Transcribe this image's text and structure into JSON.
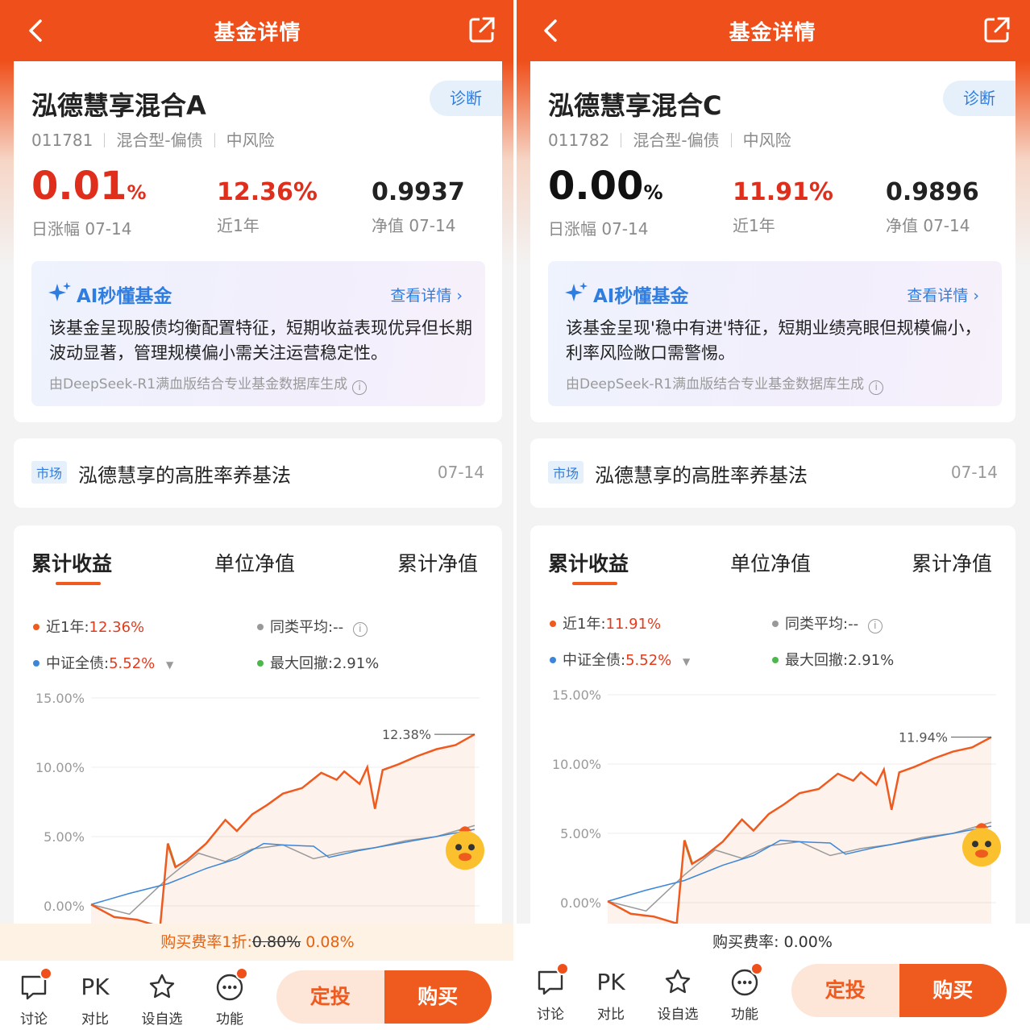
{
  "header_title": "基金详情",
  "diagnose_label": "诊断",
  "ai": {
    "title": "AI秒懂基金",
    "more": "查看详情",
    "source": "由DeepSeek-R1满血版结合专业基金数据库生成"
  },
  "news": {
    "tag": "市场",
    "title": "泓德慧享的高胜率养基法",
    "date": "07-14"
  },
  "tabs": [
    "累计收益",
    "单位净值",
    "累计净值"
  ],
  "bottom": {
    "discuss": "讨论",
    "pk": "PK",
    "compare": "对比",
    "watch": "设自选",
    "func": "功能",
    "dingtou": "定投",
    "buy": "购买"
  },
  "colors": {
    "accent": "#ef4f1a",
    "fund_line": "#ef5a1f",
    "index_line": "#3b86d8",
    "peer_line": "#999999",
    "drawdown": "#4cb84c",
    "ai_blue": "#2f7de1"
  },
  "funds": [
    {
      "name": "泓德慧享混合A",
      "code": "011781",
      "type": "混合型-偏债",
      "risk": "中风险",
      "daily_change": "0.01",
      "daily_unit": "%",
      "daily_label": "日涨幅 07-14",
      "year_return": "12.36%",
      "year_label": "近1年",
      "nav": "0.9937",
      "nav_label": "净值 07-14",
      "ai_summary": "该基金呈现股债均衡配置特征，短期收益表现优异但长期波动显著，管理规模偏小需关注运营稳定性。",
      "legend": {
        "near_year_label": "近1年:",
        "near_year": "12.36%",
        "peer_label": "同类平均:",
        "peer": "--",
        "index_label": "中证全债:",
        "index": "5.52%",
        "drawdown_label": "最大回撤:",
        "drawdown": "2.91%"
      },
      "fee_text": "购买费率1折:",
      "fee_original": "0.80%",
      "fee_value": "0.08%",
      "chart_data": {
        "type": "line",
        "yticks": [
          "15.00%",
          "10.00%",
          "5.00%",
          "0.00%"
        ],
        "ylim": [
          0,
          15
        ],
        "end_label": "12.38%",
        "series": [
          {
            "name": "近1年",
            "points": [
              [
                0,
                0.1
              ],
              [
                0.06,
                -0.8
              ],
              [
                0.12,
                -1.0
              ],
              [
                0.18,
                -1.5
              ],
              [
                0.2,
                4.5
              ],
              [
                0.22,
                2.8
              ],
              [
                0.25,
                3.3
              ],
              [
                0.3,
                4.5
              ],
              [
                0.35,
                6.2
              ],
              [
                0.38,
                5.4
              ],
              [
                0.42,
                6.6
              ],
              [
                0.46,
                7.3
              ],
              [
                0.5,
                8.1
              ],
              [
                0.55,
                8.5
              ],
              [
                0.6,
                9.6
              ],
              [
                0.64,
                9.1
              ],
              [
                0.66,
                9.7
              ],
              [
                0.7,
                8.8
              ],
              [
                0.72,
                10.0
              ],
              [
                0.74,
                7.0
              ],
              [
                0.76,
                9.8
              ],
              [
                0.8,
                10.2
              ],
              [
                0.85,
                10.8
              ],
              [
                0.9,
                11.3
              ],
              [
                0.95,
                11.6
              ],
              [
                1.0,
                12.38
              ]
            ]
          },
          {
            "name": "中证全债",
            "points": [
              [
                0,
                0.1
              ],
              [
                0.1,
                0.9
              ],
              [
                0.2,
                1.6
              ],
              [
                0.3,
                2.7
              ],
              [
                0.38,
                3.4
              ],
              [
                0.45,
                4.5
              ],
              [
                0.5,
                4.4
              ],
              [
                0.58,
                4.3
              ],
              [
                0.62,
                3.5
              ],
              [
                0.7,
                4.0
              ],
              [
                0.8,
                4.5
              ],
              [
                0.9,
                5.0
              ],
              [
                1.0,
                5.52
              ]
            ]
          },
          {
            "name": "同类平均",
            "points": [
              [
                0,
                0.1
              ],
              [
                0.1,
                -0.6
              ],
              [
                0.2,
                2.0
              ],
              [
                0.28,
                3.8
              ],
              [
                0.35,
                3.2
              ],
              [
                0.42,
                4.1
              ],
              [
                0.5,
                4.4
              ],
              [
                0.58,
                3.4
              ],
              [
                0.66,
                3.9
              ],
              [
                0.74,
                4.2
              ],
              [
                0.82,
                4.7
              ],
              [
                0.9,
                5.0
              ],
              [
                1.0,
                5.8
              ]
            ]
          }
        ]
      }
    },
    {
      "name": "泓德慧享混合C",
      "code": "011782",
      "type": "混合型-偏债",
      "risk": "中风险",
      "daily_change": "0.00",
      "daily_unit": "%",
      "daily_label": "日涨幅 07-14",
      "year_return": "11.91%",
      "year_label": "近1年",
      "nav": "0.9896",
      "nav_label": "净值 07-14",
      "ai_summary": "该基金呈现'稳中有进'特征，短期业绩亮眼但规模偏小，利率风险敞口需警惕。",
      "legend": {
        "near_year_label": "近1年:",
        "near_year": "11.91%",
        "peer_label": "同类平均:",
        "peer": "--",
        "index_label": "中证全债:",
        "index": "5.52%",
        "drawdown_label": "最大回撤:",
        "drawdown": "2.91%"
      },
      "fee_text": "购买费率:",
      "fee_original": "",
      "fee_value": "0.00%",
      "chart_data": {
        "type": "line",
        "yticks": [
          "15.00%",
          "10.00%",
          "5.00%",
          "0.00%"
        ],
        "ylim": [
          0,
          15
        ],
        "end_label": "11.94%",
        "series": [
          {
            "name": "近1年",
            "points": [
              [
                0,
                0.1
              ],
              [
                0.06,
                -0.8
              ],
              [
                0.12,
                -1.0
              ],
              [
                0.18,
                -1.5
              ],
              [
                0.2,
                4.5
              ],
              [
                0.22,
                2.8
              ],
              [
                0.25,
                3.3
              ],
              [
                0.3,
                4.4
              ],
              [
                0.35,
                6.0
              ],
              [
                0.38,
                5.2
              ],
              [
                0.42,
                6.4
              ],
              [
                0.46,
                7.1
              ],
              [
                0.5,
                7.9
              ],
              [
                0.55,
                8.2
              ],
              [
                0.6,
                9.3
              ],
              [
                0.64,
                8.8
              ],
              [
                0.66,
                9.4
              ],
              [
                0.7,
                8.5
              ],
              [
                0.72,
                9.6
              ],
              [
                0.74,
                6.7
              ],
              [
                0.76,
                9.4
              ],
              [
                0.8,
                9.8
              ],
              [
                0.85,
                10.4
              ],
              [
                0.9,
                10.9
              ],
              [
                0.95,
                11.2
              ],
              [
                1.0,
                11.94
              ]
            ]
          },
          {
            "name": "中证全债",
            "points": [
              [
                0,
                0.1
              ],
              [
                0.1,
                0.9
              ],
              [
                0.2,
                1.6
              ],
              [
                0.3,
                2.7
              ],
              [
                0.38,
                3.4
              ],
              [
                0.45,
                4.5
              ],
              [
                0.5,
                4.4
              ],
              [
                0.58,
                4.3
              ],
              [
                0.62,
                3.5
              ],
              [
                0.7,
                4.0
              ],
              [
                0.8,
                4.5
              ],
              [
                0.9,
                5.0
              ],
              [
                1.0,
                5.52
              ]
            ]
          },
          {
            "name": "同类平均",
            "points": [
              [
                0,
                0.1
              ],
              [
                0.1,
                -0.6
              ],
              [
                0.2,
                2.0
              ],
              [
                0.28,
                3.8
              ],
              [
                0.35,
                3.2
              ],
              [
                0.42,
                4.1
              ],
              [
                0.5,
                4.4
              ],
              [
                0.58,
                3.4
              ],
              [
                0.66,
                3.9
              ],
              [
                0.74,
                4.2
              ],
              [
                0.82,
                4.7
              ],
              [
                0.9,
                5.0
              ],
              [
                1.0,
                5.8
              ]
            ]
          }
        ]
      }
    }
  ]
}
